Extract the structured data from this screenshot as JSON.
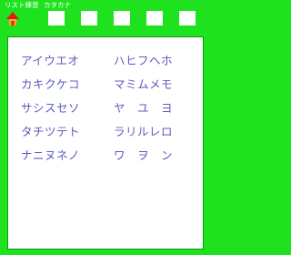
{
  "title_bar": {
    "app_title": "リスト練習",
    "sub_title": "カタカナ"
  },
  "toolbar": {
    "home_icon": "home-icon",
    "home_icon_colors": {
      "roof": "#e11b1b",
      "base": "#f5a623"
    },
    "buttons": [
      "",
      "",
      "",
      "",
      ""
    ]
  },
  "kana_list": {
    "left": [
      "アイウエオ",
      "カキクケコ",
      "サシスセソ",
      "タチツテト",
      "ナニヌネノ"
    ],
    "right": [
      "ハヒフヘホ",
      "マミムメモ",
      "ヤ　ユ　ヨ",
      "ラリルレロ",
      "ワ　ヲ　ン"
    ]
  },
  "colors": {
    "background": "#1ee21e",
    "panel": "#ffffff",
    "text": "#5c5cc0"
  }
}
